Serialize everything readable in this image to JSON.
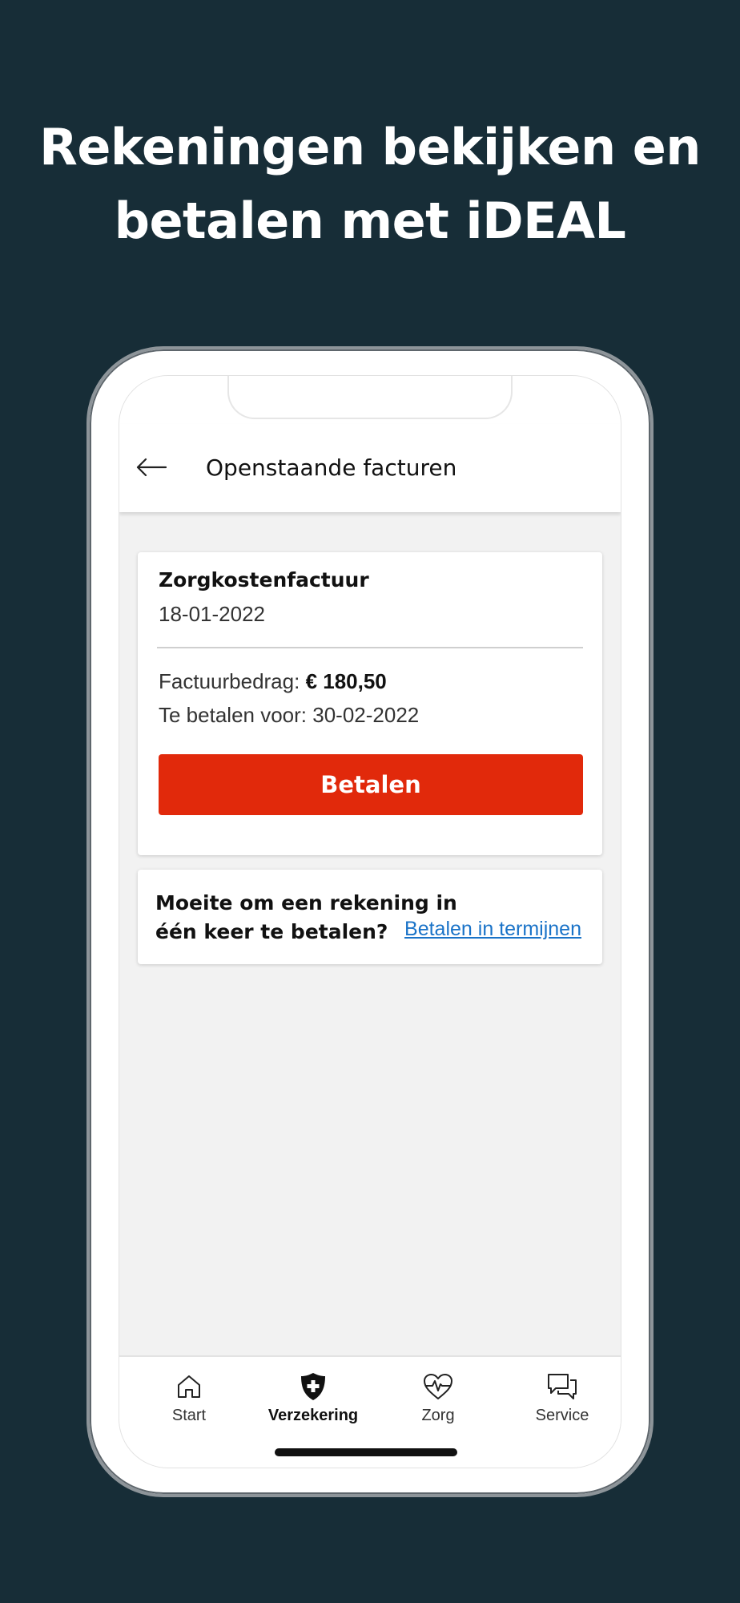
{
  "headline": {
    "line1": "Rekeningen bekijken en",
    "line2": "betalen met iDEAL"
  },
  "appbar": {
    "title": "Openstaande facturen",
    "back_icon": "arrow-left-icon"
  },
  "invoice": {
    "title": "Zorgkostenfactuur",
    "date": "18-01-2022",
    "amount_label": "Factuurbedrag:",
    "amount_value": "€ 180,50",
    "due_label": "Te betalen voor:",
    "due_date": "30-02-2022",
    "pay_button_label": "Betalen"
  },
  "installments": {
    "question_line1": "Moeite om een rekening in",
    "question_line2": "één keer te betalen?",
    "link_label": "Betalen in termijnen"
  },
  "bottom_nav": {
    "items": [
      {
        "label": "Start",
        "icon": "home-icon",
        "active": false
      },
      {
        "label": "Verzekering",
        "icon": "shield-cross-icon",
        "active": true
      },
      {
        "label": "Zorg",
        "icon": "heart-pulse-icon",
        "active": false
      },
      {
        "label": "Service",
        "icon": "chat-bubbles-icon",
        "active": false
      }
    ]
  },
  "colors": {
    "background": "#172d37",
    "primary_button": "#e1290b",
    "link": "#1a73c8"
  }
}
